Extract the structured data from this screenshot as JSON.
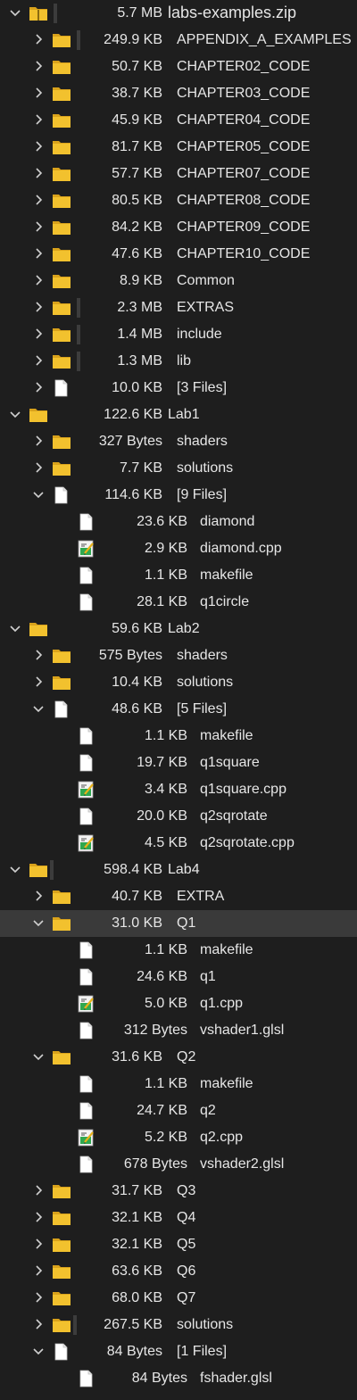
{
  "tree": [
    {
      "d": 0,
      "exp": true,
      "type": "zip",
      "size": "5.7 MB",
      "name": "labs-examples.zip",
      "root": true
    },
    {
      "d": 1,
      "exp": false,
      "type": "folder",
      "size": "249.9 KB",
      "name": "APPENDIX_A_EXAMPLES"
    },
    {
      "d": 1,
      "exp": false,
      "type": "folder",
      "size": "50.7 KB",
      "name": "CHAPTER02_CODE"
    },
    {
      "d": 1,
      "exp": false,
      "type": "folder",
      "size": "38.7 KB",
      "name": "CHAPTER03_CODE"
    },
    {
      "d": 1,
      "exp": false,
      "type": "folder",
      "size": "45.9 KB",
      "name": "CHAPTER04_CODE"
    },
    {
      "d": 1,
      "exp": false,
      "type": "folder",
      "size": "81.7 KB",
      "name": "CHAPTER05_CODE"
    },
    {
      "d": 1,
      "exp": false,
      "type": "folder",
      "size": "57.7 KB",
      "name": "CHAPTER07_CODE"
    },
    {
      "d": 1,
      "exp": false,
      "type": "folder",
      "size": "80.5 KB",
      "name": "CHAPTER08_CODE"
    },
    {
      "d": 1,
      "exp": false,
      "type": "folder",
      "size": "84.2 KB",
      "name": "CHAPTER09_CODE"
    },
    {
      "d": 1,
      "exp": false,
      "type": "folder",
      "size": "47.6 KB",
      "name": "CHAPTER10_CODE"
    },
    {
      "d": 1,
      "exp": false,
      "type": "folder",
      "size": "8.9 KB",
      "name": "Common"
    },
    {
      "d": 1,
      "exp": false,
      "type": "folder",
      "size": "2.3 MB",
      "name": "EXTRAS"
    },
    {
      "d": 1,
      "exp": false,
      "type": "folder",
      "size": "1.4 MB",
      "name": "include"
    },
    {
      "d": 1,
      "exp": false,
      "type": "folder",
      "size": "1.3 MB",
      "name": "lib"
    },
    {
      "d": 1,
      "exp": false,
      "type": "files",
      "size": "10.0 KB",
      "name": "[3 Files]"
    },
    {
      "d": 0,
      "exp": true,
      "type": "folder",
      "size": "122.6 KB",
      "name": "Lab1"
    },
    {
      "d": 1,
      "exp": false,
      "type": "folder",
      "size": "327 Bytes",
      "name": "shaders"
    },
    {
      "d": 1,
      "exp": false,
      "type": "folder",
      "size": "7.7 KB",
      "name": "solutions"
    },
    {
      "d": 1,
      "exp": true,
      "type": "files",
      "size": "114.6 KB",
      "name": "[9 Files]"
    },
    {
      "d": 2,
      "type": "file",
      "size": "23.6 KB",
      "name": "diamond"
    },
    {
      "d": 2,
      "type": "cpp",
      "size": "2.9 KB",
      "name": "diamond.cpp"
    },
    {
      "d": 2,
      "type": "file",
      "size": "1.1 KB",
      "name": "makefile"
    },
    {
      "d": 2,
      "type": "file",
      "size": "28.1 KB",
      "name": "q1circle"
    },
    {
      "d": 0,
      "exp": true,
      "type": "folder",
      "size": "59.6 KB",
      "name": "Lab2"
    },
    {
      "d": 1,
      "exp": false,
      "type": "folder",
      "size": "575 Bytes",
      "name": "shaders"
    },
    {
      "d": 1,
      "exp": false,
      "type": "folder",
      "size": "10.4 KB",
      "name": "solutions"
    },
    {
      "d": 1,
      "exp": true,
      "type": "files",
      "size": "48.6 KB",
      "name": "[5 Files]"
    },
    {
      "d": 2,
      "type": "file",
      "size": "1.1 KB",
      "name": "makefile"
    },
    {
      "d": 2,
      "type": "file",
      "size": "19.7 KB",
      "name": "q1square"
    },
    {
      "d": 2,
      "type": "cpp",
      "size": "3.4 KB",
      "name": "q1square.cpp"
    },
    {
      "d": 2,
      "type": "file",
      "size": "20.0 KB",
      "name": "q2sqrotate"
    },
    {
      "d": 2,
      "type": "cpp",
      "size": "4.5 KB",
      "name": "q2sqrotate.cpp"
    },
    {
      "d": 0,
      "exp": true,
      "type": "folder",
      "size": "598.4 KB",
      "name": "Lab4"
    },
    {
      "d": 1,
      "exp": false,
      "type": "folder",
      "size": "40.7 KB",
      "name": "EXTRA"
    },
    {
      "d": 1,
      "exp": true,
      "type": "folder",
      "size": "31.0 KB",
      "name": "Q1",
      "selected": true
    },
    {
      "d": 2,
      "type": "file",
      "size": "1.1 KB",
      "name": "makefile"
    },
    {
      "d": 2,
      "type": "file",
      "size": "24.6 KB",
      "name": "q1"
    },
    {
      "d": 2,
      "type": "cpp",
      "size": "5.0 KB",
      "name": "q1.cpp"
    },
    {
      "d": 2,
      "type": "file",
      "size": "312 Bytes",
      "name": "vshader1.glsl"
    },
    {
      "d": 1,
      "exp": true,
      "type": "folder",
      "size": "31.6 KB",
      "name": "Q2"
    },
    {
      "d": 2,
      "type": "file",
      "size": "1.1 KB",
      "name": "makefile"
    },
    {
      "d": 2,
      "type": "file",
      "size": "24.7 KB",
      "name": "q2"
    },
    {
      "d": 2,
      "type": "cpp",
      "size": "5.2 KB",
      "name": "q2.cpp"
    },
    {
      "d": 2,
      "type": "file",
      "size": "678 Bytes",
      "name": "vshader2.glsl"
    },
    {
      "d": 1,
      "exp": false,
      "type": "folder",
      "size": "31.7 KB",
      "name": "Q3"
    },
    {
      "d": 1,
      "exp": false,
      "type": "folder",
      "size": "32.1 KB",
      "name": "Q4"
    },
    {
      "d": 1,
      "exp": false,
      "type": "folder",
      "size": "32.1 KB",
      "name": "Q5"
    },
    {
      "d": 1,
      "exp": false,
      "type": "folder",
      "size": "63.6 KB",
      "name": "Q6"
    },
    {
      "d": 1,
      "exp": false,
      "type": "folder",
      "size": "68.0 KB",
      "name": "Q7"
    },
    {
      "d": 1,
      "exp": false,
      "type": "folder",
      "size": "267.5 KB",
      "name": "solutions"
    },
    {
      "d": 1,
      "exp": true,
      "type": "files",
      "size": "84 Bytes",
      "name": "[1 Files]"
    },
    {
      "d": 2,
      "type": "file",
      "size": "84 Bytes",
      "name": "fshader.glsl"
    }
  ],
  "colors": {
    "background": "#1e1e1e",
    "text": "#e6e6e6",
    "folder": "#f2c12e",
    "folder_dark": "#d9a21b",
    "selected_row": "#3a3a3a"
  }
}
